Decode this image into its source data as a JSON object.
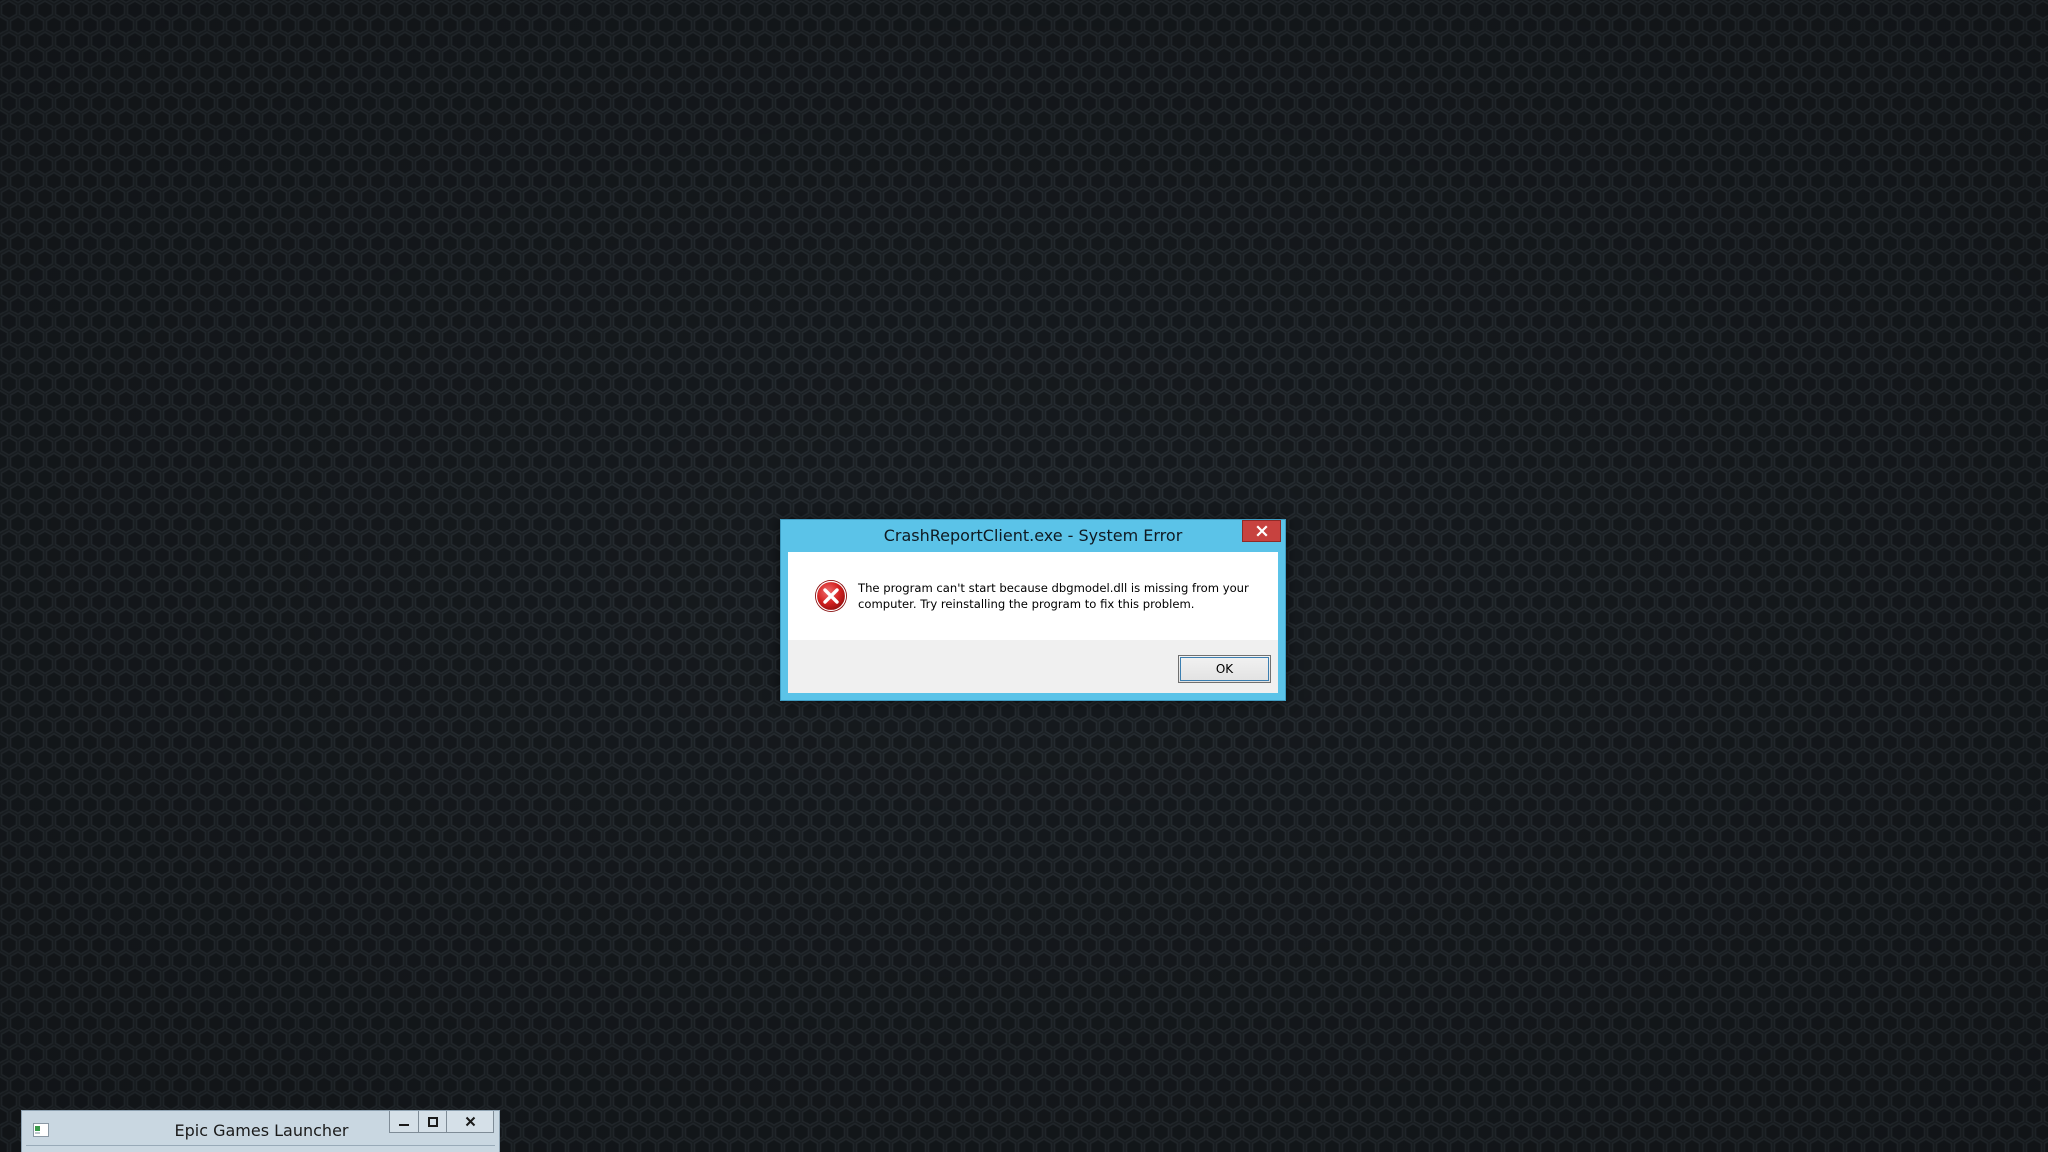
{
  "desktop": {
    "background_color": "#1b2024",
    "pattern_color": "#252b30"
  },
  "error_dialog": {
    "title": "CrashReportClient.exe - System Error",
    "message_line1": "The program can't start because dbgmodel.dll is missing from your",
    "message_line2": "computer. Try reinstalling the program to fix this problem.",
    "icon": "error-icon",
    "ok_label": "OK",
    "titlebar_color": "#5bc3e8",
    "close_color": "#c7423f"
  },
  "minimized_window": {
    "title": "Epic Games Launcher",
    "controls": [
      "minimize",
      "maximize",
      "close"
    ]
  }
}
